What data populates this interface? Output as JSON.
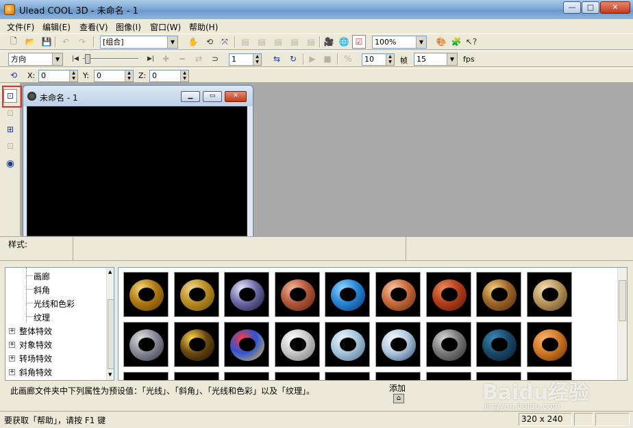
{
  "window": {
    "title": "Ulead COOL 3D - 未命名 - 1"
  },
  "menu": [
    "文件(F)",
    "编辑(E)",
    "查看(V)",
    "图像(I)",
    "窗口(W)",
    "帮助(H)"
  ],
  "toolbar1": {
    "object_combo": "[组合]",
    "zoom_combo": "100%"
  },
  "toolbar2": {
    "mode_combo": "方向",
    "frame_value": "1",
    "speed_value": "10",
    "frame_label": "帧",
    "fps_value": "15",
    "fps_label": "fps"
  },
  "toolbar3": {
    "x_label": "X:",
    "x_value": "0",
    "y_label": "Y:",
    "y_value": "0",
    "z_label": "Z:",
    "z_value": "0"
  },
  "document": {
    "title": "未命名 - 1"
  },
  "style_bar": {
    "label": "样式:"
  },
  "tree": {
    "children": [
      "画廊",
      "斜角",
      "光线和色彩",
      "纹理"
    ],
    "groups": [
      "整体特效",
      "对象特效",
      "转场特效",
      "斜角特效"
    ]
  },
  "gallery": {
    "presets": [
      {
        "colors": [
          "#f6d77a",
          "#b07a14",
          "#5a3a00"
        ]
      },
      {
        "colors": [
          "#f2d98a",
          "#b88c25",
          "#6b4a07"
        ]
      },
      {
        "colors": [
          "#e8e8ff",
          "#6c6ca8",
          "#14142e"
        ]
      },
      {
        "colors": [
          "#f3b79a",
          "#b5583a",
          "#5a2410"
        ]
      },
      {
        "colors": [
          "#8fd7ff",
          "#2a86d6",
          "#0a3470"
        ]
      },
      {
        "colors": [
          "#f6c5a0",
          "#c96b3c",
          "#5c2a10"
        ]
      },
      {
        "colors": [
          "#f08a5a",
          "#b33f1a",
          "#55160a"
        ]
      },
      {
        "colors": [
          "#f3cf7a",
          "#a0652a",
          "#4a2a0a"
        ]
      },
      {
        "colors": [
          "#f3e0b5",
          "#b8955a",
          "#5a4220"
        ]
      },
      {
        "colors": [
          "#e0e0e0",
          "#8a8a98",
          "#303040"
        ]
      },
      {
        "colors": [
          "#ffd84a",
          "#6a4a10",
          "#1a1000"
        ]
      },
      {
        "colors": [
          "#ff3a3a",
          "#2a54d6",
          "#f3c23a"
        ]
      },
      {
        "colors": [
          "#ffffff",
          "#c8c8c8",
          "#707070"
        ]
      },
      {
        "colors": [
          "#e8f4ff",
          "#a8c6dc",
          "#4a6a84"
        ]
      },
      {
        "colors": [
          "#f8f8f8",
          "#b0c8e0",
          "#2a4a6a"
        ]
      },
      {
        "colors": [
          "#d8d8d8",
          "#7a7a7a",
          "#2a2a2a"
        ]
      },
      {
        "colors": [
          "#3a8ab8",
          "#1a4a6a",
          "#0a1a2a"
        ]
      },
      {
        "colors": [
          "#f7b46a",
          "#d07826",
          "#6a3008"
        ]
      }
    ]
  },
  "description": "此画廊文件夹中下列属性为预设值：「光线」、「斜角」、「光线和色彩」以及「纹理」。",
  "add_button": {
    "label": "添加"
  },
  "status": {
    "message": "要获取「帮助」，请按 F1 键",
    "size": "320 x 240"
  },
  "watermark": {
    "text": "Baidu经验",
    "url": "jingyan.baidu.com"
  }
}
